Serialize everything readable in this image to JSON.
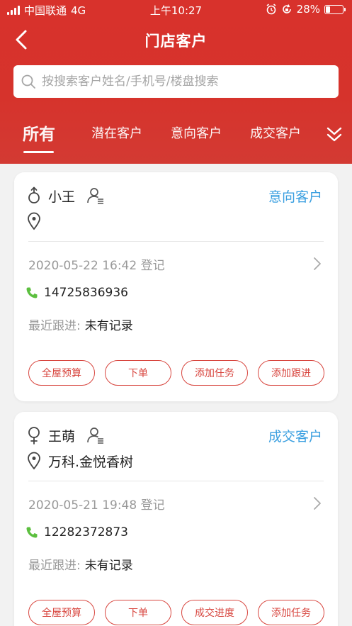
{
  "status_bar": {
    "carrier": "中国联通",
    "network": "4G",
    "time": "上午10:27",
    "battery": "28%",
    "battery_level": 0.28
  },
  "nav": {
    "title": "门店客户"
  },
  "search": {
    "placeholder": "按搜索客户姓名/手机号/楼盘搜索",
    "value": ""
  },
  "tabs": [
    {
      "label": "所有",
      "active": true
    },
    {
      "label": "潜在客户",
      "active": false
    },
    {
      "label": "意向客户",
      "active": false
    },
    {
      "label": "成交客户",
      "active": false
    }
  ],
  "customers": [
    {
      "gender": "male",
      "name": "小王",
      "status": "意向客户",
      "address": "",
      "register_time": "2020-05-22 16:42 登记",
      "phone": "14725836936",
      "follow_label": "最近跟进:",
      "follow_value": "未有记录",
      "actions": [
        "全屋预算",
        "下单",
        "添加任务",
        "添加跟进"
      ]
    },
    {
      "gender": "female",
      "name": "王萌",
      "status": "成交客户",
      "address": "万科.金悦香树",
      "register_time": "2020-05-21 19:48 登记",
      "phone": "12282372873",
      "follow_label": "最近跟进:",
      "follow_value": "未有记录",
      "actions": [
        "全屋预算",
        "下单",
        "成交进度",
        "添加任务"
      ]
    }
  ],
  "colors": {
    "header": "#d8322c",
    "accent_blue": "#3a9fe0",
    "button_red": "#d8463f",
    "phone_green": "#5cbf3f"
  }
}
